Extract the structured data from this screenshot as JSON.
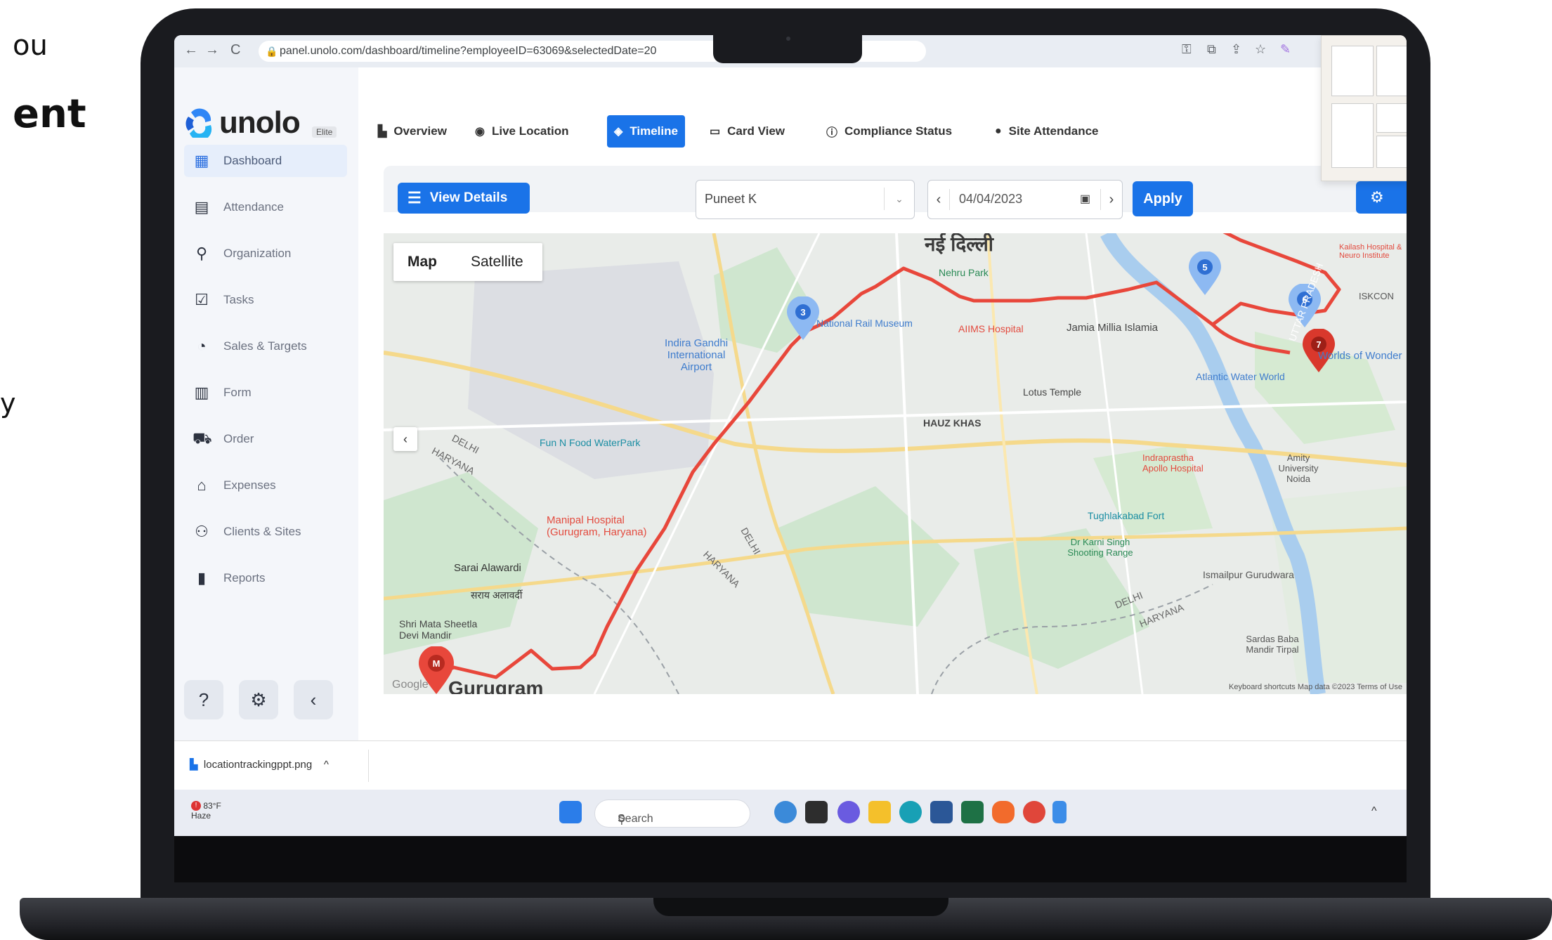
{
  "backdrop": {
    "line1": "ou",
    "line2": "ent",
    "line3": "y"
  },
  "browser": {
    "url": "panel.unolo.com/dashboard/timeline?employeeID=63069&selectedDate=20",
    "back": "←",
    "forward": "→",
    "reload": "C"
  },
  "app": {
    "logo_text": "unolo",
    "badge": "Elite",
    "sidebar": {
      "items": [
        {
          "label": "Dashboard",
          "icon": "dashboard-icon",
          "glyph": "▦"
        },
        {
          "label": "Attendance",
          "icon": "calendar-icon",
          "glyph": "▤"
        },
        {
          "label": "Organization",
          "icon": "person-icon",
          "glyph": "⚲"
        },
        {
          "label": "Tasks",
          "icon": "checkbox-icon",
          "glyph": "☑"
        },
        {
          "label": "Sales & Targets",
          "icon": "sales-icon",
          "glyph": "◔"
        },
        {
          "label": "Form",
          "icon": "form-icon",
          "glyph": "▥"
        },
        {
          "label": "Order",
          "icon": "truck-icon",
          "glyph": "⛟"
        },
        {
          "label": "Expenses",
          "icon": "bank-icon",
          "glyph": "⌂"
        },
        {
          "label": "Clients & Sites",
          "icon": "people-icon",
          "glyph": "⚇"
        },
        {
          "label": "Reports",
          "icon": "document-icon",
          "glyph": "▮"
        }
      ],
      "bottom": {
        "help": "?",
        "settings": "⚙",
        "collapse": "‹"
      }
    },
    "tabs": [
      {
        "label": "Overview",
        "glyph": "▙"
      },
      {
        "label": "Live Location",
        "glyph": "◉"
      },
      {
        "label": "Timeline",
        "glyph": "◈"
      },
      {
        "label": "Card View",
        "glyph": "▭"
      },
      {
        "label": "Compliance Status",
        "glyph": "ⓘ"
      },
      {
        "label": "Site Attendance",
        "glyph": "●"
      }
    ],
    "controls": {
      "view_details": "View Details",
      "employee": "Puneet K",
      "date": "04/04/2023",
      "apply": "Apply",
      "prev": "‹",
      "next": "›",
      "calendar": "▣",
      "dropdown": "⌄"
    },
    "map": {
      "toggle": {
        "map": "Map",
        "satellite": "Satellite"
      },
      "labels": {
        "city": "नई दिल्ली",
        "airport": "Indira Gandhi International Airport",
        "fun": "Fun N Food WaterPark",
        "medanta": "Manipal Hospital (Gurugram, Haryana)",
        "sarai": "Sarai Alawardi",
        "sarai2": "सराय अलावर्दी",
        "mata": "Shri Mata Sheetla Devi Mandir",
        "hauz": "HAUZ KHAS",
        "lotus": "Lotus Temple",
        "jamia": "Jamia Millia Islamia",
        "aiims": "AIIMS Hospital",
        "railmuseum": "National Rail Museum",
        "nehru": "Nehru Park",
        "apollo": "Indraprastha Apollo Hospital",
        "amity": "Amity University Noida",
        "wow": "Worlds of Wonder",
        "atlantic": "Atlantic Water World",
        "tughlakabad": "Tughlakabad Fort",
        "karni": "Dr Karni Singh Shooting Range",
        "ismailpur": "Ismailpur Gurudwara",
        "iskcon": "ISKCON",
        "sardas": "Sardas Baba Mandir Tirpal",
        "kailash": "Kailash Hospital & Neuro Institute",
        "delhi1": "DELHI",
        "haryana1": "HARYANA",
        "delhi2": "DELHI",
        "haryana2": "HARYANA",
        "delhi3": "DELHI",
        "haryana3": "HARYANA",
        "gurugram": "Gurugram",
        "up": "UTTAR PRADESH",
        "google": "Google",
        "keys": "Keyboard shortcuts   Map data ©2023   Terms of Use"
      },
      "markers": {
        "m3": "3",
        "m5": "5",
        "m6": "6",
        "m7": "7",
        "start": "M"
      }
    },
    "download": {
      "file": "locationtrackingppt.png",
      "chevron": "^"
    },
    "taskbar": {
      "search": "Search",
      "weather_temp": "83°F",
      "weather_desc": "Haze",
      "alert": "!"
    }
  }
}
